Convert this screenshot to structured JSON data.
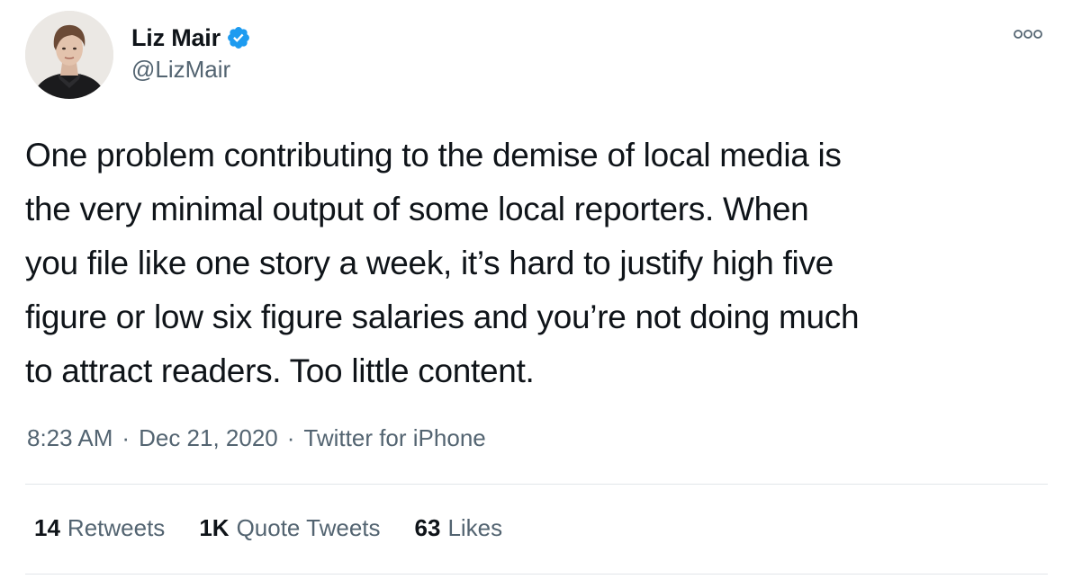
{
  "author": {
    "display_name": "Liz Mair",
    "handle": "@LizMair",
    "verified": true,
    "verified_color": "#1d9bf0"
  },
  "tweet": {
    "text": "One problem contributing to the demise of local media is\nthe very minimal output of some local reporters. When\nyou file like one story a week, it’s hard to justify high five\nfigure or low six figure salaries and you’re not doing much\nto attract readers. Too little content."
  },
  "meta": {
    "time": "8:23 AM",
    "separator": "·",
    "date": "Dec 21, 2020",
    "source": "Twitter for iPhone"
  },
  "stats": {
    "retweets_count": "14",
    "retweets_label": "Retweets",
    "quote_tweets_count": "1K",
    "quote_tweets_label": "Quote Tweets",
    "likes_count": "63",
    "likes_label": "Likes"
  },
  "icons": {
    "more": "more-options-icon",
    "verified": "verified-badge-icon",
    "avatar": "profile-photo"
  }
}
